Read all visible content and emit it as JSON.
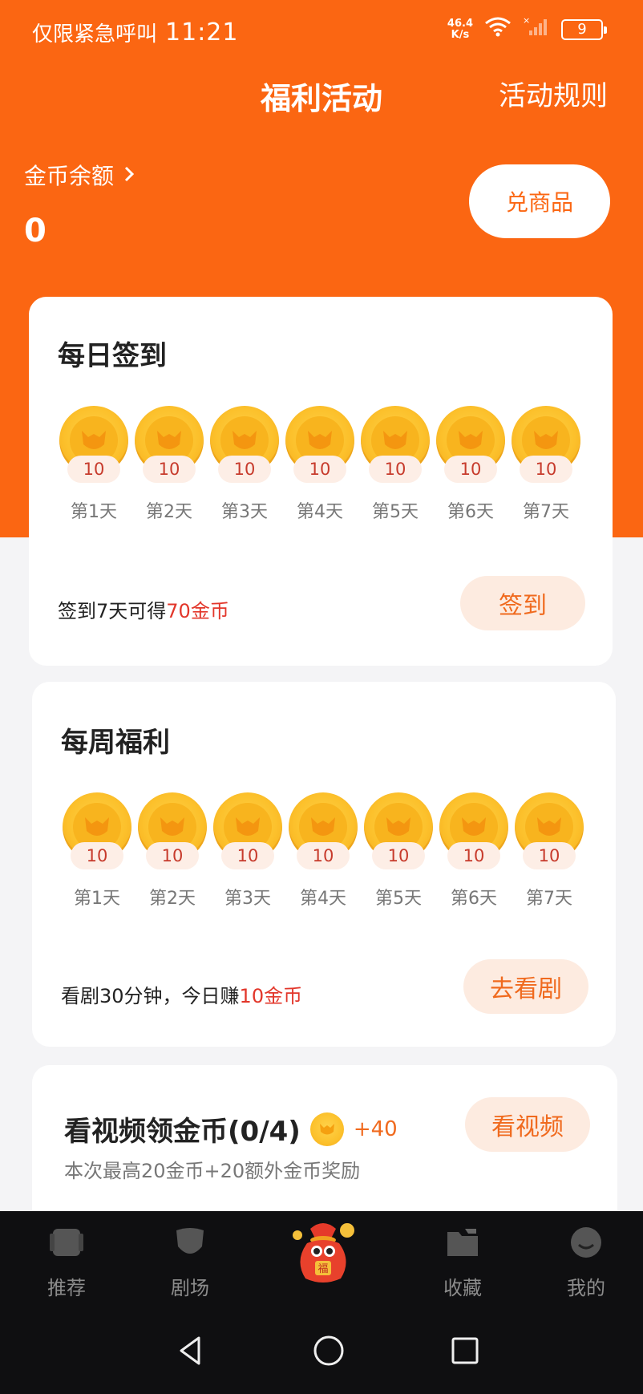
{
  "status_bar": {
    "carrier_text": "仅限紧急呼叫",
    "time": "11:21",
    "net_speed_value": "46.4",
    "net_speed_unit": "K/s",
    "battery": "9"
  },
  "header": {
    "title": "福利活动",
    "rules_link": "活动规则",
    "balance_label": "金币余额",
    "balance_value": "0",
    "exchange_button": "兑商品"
  },
  "daily_checkin": {
    "title": "每日签到",
    "days": [
      {
        "amount": "10",
        "label": "第1天"
      },
      {
        "amount": "10",
        "label": "第2天"
      },
      {
        "amount": "10",
        "label": "第3天"
      },
      {
        "amount": "10",
        "label": "第4天"
      },
      {
        "amount": "10",
        "label": "第5天"
      },
      {
        "amount": "10",
        "label": "第6天"
      },
      {
        "amount": "10",
        "label": "第7天"
      }
    ],
    "desc_prefix": "签到7天可得",
    "desc_highlight": "70金币",
    "button": "签到"
  },
  "weekly_benefit": {
    "title": "每周福利",
    "days": [
      {
        "amount": "10",
        "label": "第1天"
      },
      {
        "amount": "10",
        "label": "第2天"
      },
      {
        "amount": "10",
        "label": "第3天"
      },
      {
        "amount": "10",
        "label": "第4天"
      },
      {
        "amount": "10",
        "label": "第5天"
      },
      {
        "amount": "10",
        "label": "第6天"
      },
      {
        "amount": "10",
        "label": "第7天"
      }
    ],
    "desc_prefix": "看剧30分钟，今日赚",
    "desc_highlight": "10金币",
    "button": "去看剧"
  },
  "video_task": {
    "title": "看视频领金币(0/4)",
    "reward": "+40",
    "subtitle": "本次最高20金币+20额外金币奖励",
    "button": "看视频"
  },
  "tab_bar": {
    "items": [
      {
        "label": "推荐",
        "icon": "recommend-icon"
      },
      {
        "label": "剧场",
        "icon": "theater-icon"
      },
      {
        "label": "",
        "icon": "fortune-bag-icon"
      },
      {
        "label": "收藏",
        "icon": "folder-icon"
      },
      {
        "label": "我的",
        "icon": "profile-icon"
      }
    ]
  },
  "nav_bar": {
    "icons": [
      "back-icon",
      "home-icon",
      "recents-icon"
    ]
  },
  "colors": {
    "brand_orange": "#fb6612",
    "highlight_red": "#e2362a",
    "coin_gold": "#fcc12c"
  }
}
